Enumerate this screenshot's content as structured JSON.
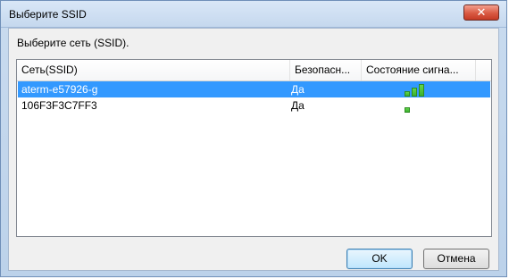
{
  "window": {
    "title": "Выберите SSID",
    "close_label": "✕"
  },
  "prompt": "Выберите сеть (SSID).",
  "list": {
    "columns": [
      "Сеть(SSID)",
      "Безопасн...",
      "Состояние сигна..."
    ],
    "rows": [
      {
        "ssid": "aterm-e57926-g",
        "security": "Да",
        "signal_bars": 3,
        "selected": true
      },
      {
        "ssid": "106F3F3C7FF3",
        "security": "Да",
        "signal_bars": 1,
        "selected": false
      }
    ]
  },
  "buttons": {
    "ok": "OK",
    "cancel": "Отмена"
  },
  "colors": {
    "selection": "#3399ff",
    "signal_green": "#3cb22e",
    "close_red": "#d95a43"
  }
}
